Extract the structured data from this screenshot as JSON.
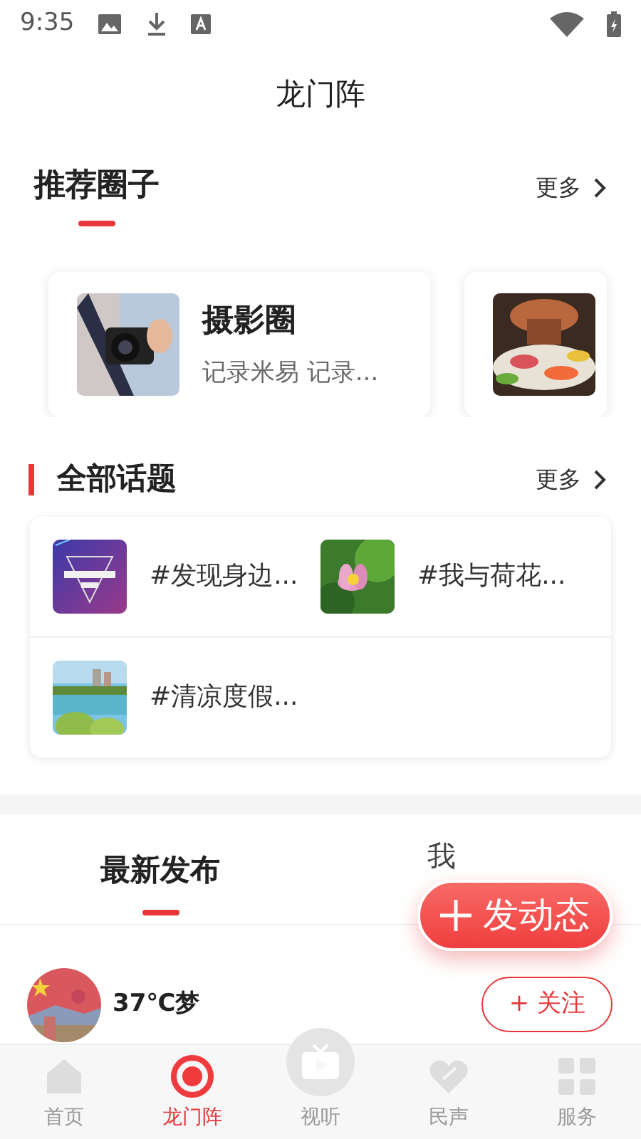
{
  "status_bar": {
    "time": "9:35"
  },
  "header": {
    "title": "龙门阵"
  },
  "circles_section": {
    "title": "推荐圈子",
    "more": "更多",
    "items": [
      {
        "name": "摄影圈",
        "desc": "记录米易 记录...",
        "kind": "picture"
      },
      {
        "kind": "picture"
      }
    ]
  },
  "topics_section": {
    "title": "全部话题",
    "more": "更多",
    "items": [
      {
        "label": "#发现身边..."
      },
      {
        "label": "#我与荷花..."
      },
      {
        "label": "#清凉度假..."
      }
    ]
  },
  "feed_tabs": [
    {
      "label": "最新发布",
      "selected": true
    },
    {
      "label": "我",
      "selected": false
    }
  ],
  "post_button": {
    "label": "发动态"
  },
  "posts": [
    {
      "user": "37℃梦",
      "follow": "+ 关注"
    }
  ],
  "bottom_nav": [
    {
      "label": "首页",
      "selected": false
    },
    {
      "label": "龙门阵",
      "selected": true
    },
    {
      "label": "视听",
      "selected": false
    },
    {
      "label": "民声",
      "selected": false
    },
    {
      "label": "服务",
      "selected": false
    }
  ]
}
